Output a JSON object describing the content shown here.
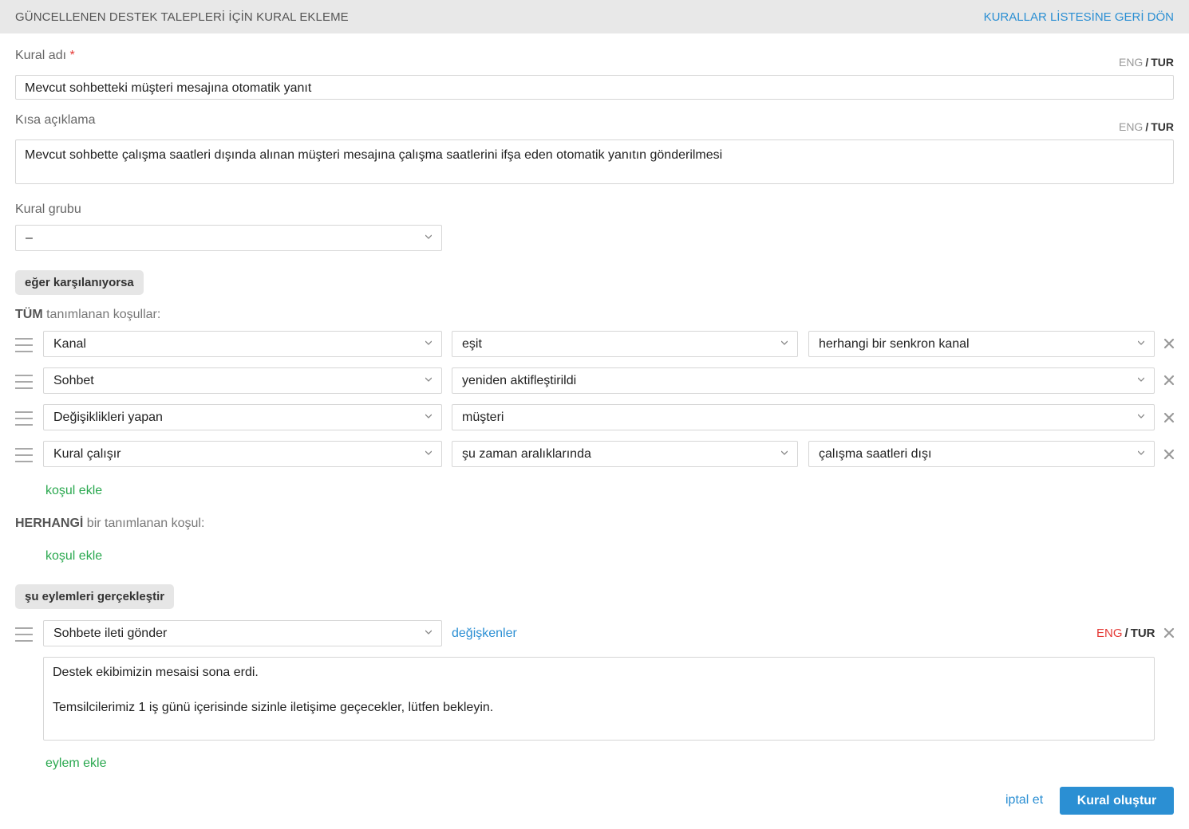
{
  "header": {
    "title": "GÜNCELLENEN DESTEK TALEPLERİ İÇİN KURAL EKLEME",
    "back_link": "KURALLAR LİSTESİNE GERİ DÖN"
  },
  "lang_switch": {
    "eng": "ENG",
    "sep": "/",
    "tur": "TUR"
  },
  "rule_name": {
    "label": "Kural adı",
    "required_mark": "*",
    "value": "Mevcut sohbetteki müşteri mesajına otomatik yanıt"
  },
  "short_desc": {
    "label": "Kısa açıklama",
    "value": "Mevcut sohbette çalışma saatleri dışında alınan müşteri mesajına çalışma saatlerini ifşa eden otomatik yanıtın gönderilmesi"
  },
  "rule_group": {
    "label": "Kural grubu",
    "value": "–"
  },
  "if_section": {
    "pill": "eğer karşılanıyorsa",
    "all_prefix": "TÜM",
    "all_suffix": "tanımlanan koşullar:",
    "any_prefix": "HERHANGİ",
    "any_suffix": "bir tanımlanan koşul:",
    "add_condition": "koşul ekle",
    "conditions": [
      {
        "field": "Kanal",
        "operator": "eşit",
        "value": "herhangi bir senkron kanal"
      },
      {
        "field": "Sohbet",
        "operator": "yeniden aktifleştirildi"
      },
      {
        "field": "Değişiklikleri yapan",
        "operator": "müşteri"
      },
      {
        "field": "Kural çalışır",
        "operator": "şu zaman aralıklarında",
        "value": "çalışma saatleri dışı"
      }
    ]
  },
  "actions_section": {
    "pill": "şu eylemleri gerçekleştir",
    "action": "Sohbete ileti gönder",
    "variables_link": "değişkenler",
    "message_line1": "Destek ekibimizin mesaisi sona erdi.",
    "message_line2": "Temsilcilerimiz 1 iş günü içerisinde sizinle iletişime geçecekler, lütfen bekleyin.",
    "add_action": "eylem ekle"
  },
  "footer": {
    "cancel": "iptal et",
    "submit": "Kural oluştur"
  },
  "colors": {
    "accent": "#2b8fd3",
    "green": "#2aa84f",
    "required": "#e53935"
  },
  "icons": {
    "chevron": "chevron-down-icon",
    "drag": "drag-handle-icon",
    "remove": "close-icon"
  }
}
